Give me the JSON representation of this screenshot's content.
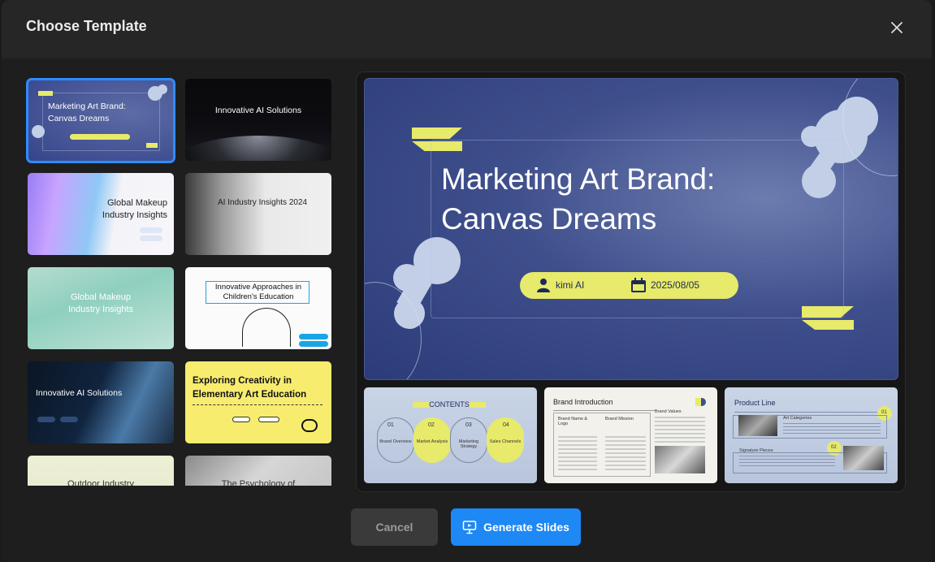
{
  "dialog": {
    "title": "Choose Template",
    "cancel_label": "Cancel",
    "generate_label": "Generate Slides"
  },
  "templates": [
    {
      "title": "Marketing Art Brand: Canvas Dreams",
      "selected": true
    },
    {
      "title": "Innovative AI Solutions"
    },
    {
      "title": "Global Makeup Industry Insights"
    },
    {
      "title": "AI Industry Insights 2024"
    },
    {
      "title": "Global Makeup Industry Insights"
    },
    {
      "title": "Innovative Approaches in Children's Education"
    },
    {
      "title": "Innovative AI Solutions"
    },
    {
      "title": "Exploring Creativity in Elementary Art Education"
    },
    {
      "title": "Outdoor Industry"
    },
    {
      "title": "The Psychology of"
    }
  ],
  "preview": {
    "title_line1": "Marketing Art Brand:",
    "title_line2": "Canvas Dreams",
    "author": "kimi AI",
    "date": "2025/08/05",
    "slides": [
      {
        "heading": "CONTENTS",
        "items": [
          {
            "num": "01",
            "label": "Brand Overview"
          },
          {
            "num": "02",
            "label": "Market Analysis"
          },
          {
            "num": "03",
            "label": "Marketing Strategy"
          },
          {
            "num": "04",
            "label": "Sales Channels"
          }
        ]
      },
      {
        "heading": "Brand Introduction",
        "cols": [
          "Brand Name & Logo",
          "Brand Mission",
          "Brand Values"
        ]
      },
      {
        "heading": "Product Line",
        "items": [
          {
            "num": "01",
            "label": "Art Categories"
          },
          {
            "num": "02",
            "label": "Signature Pieces"
          }
        ]
      }
    ]
  },
  "colors": {
    "accent": "#1e88f5",
    "brand_yellow": "#e7ea6a",
    "brand_blue": "#3f4f8c"
  }
}
